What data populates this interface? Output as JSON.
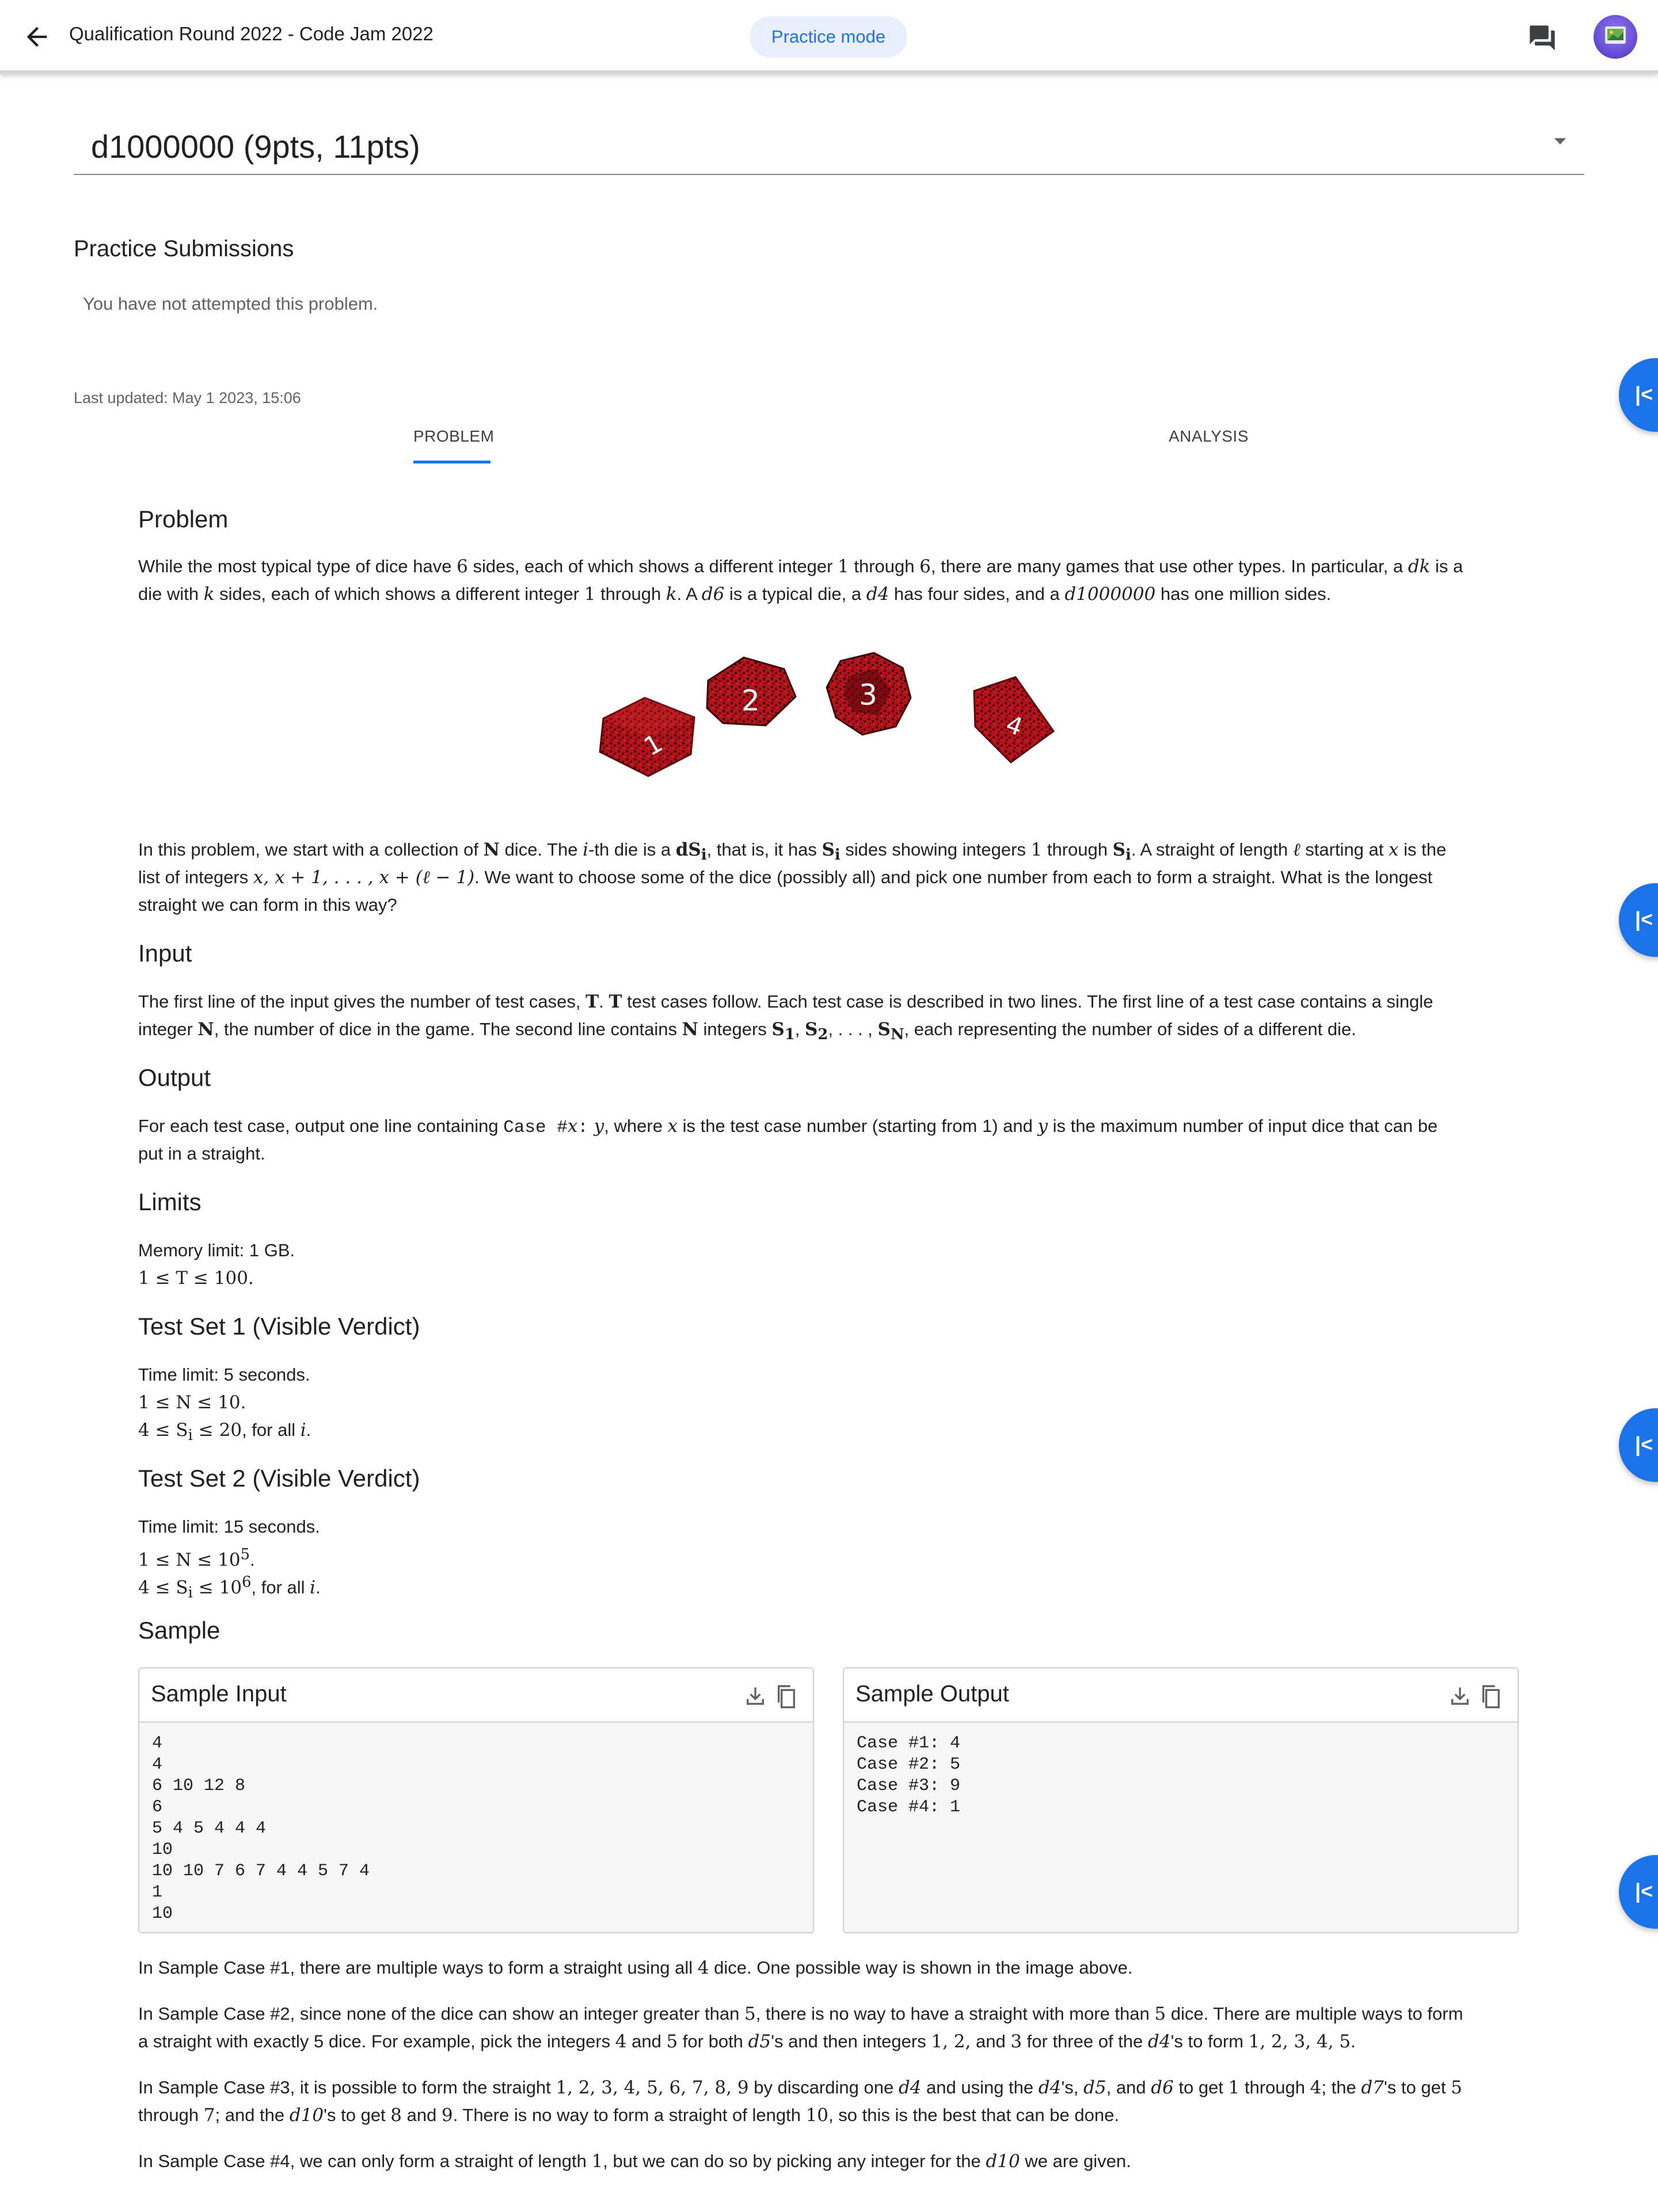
{
  "header": {
    "title": "Qualification Round 2022 - Code Jam 2022",
    "mode_chip": "Practice mode",
    "back_icon": "arrow-back-icon",
    "feedback_icon": "feedback-icon"
  },
  "problem_selector": {
    "title": "d1000000 (9pts, 11pts)"
  },
  "practice": {
    "heading": "Practice Submissions",
    "empty_text": "You have not attempted this problem.",
    "last_updated": "Last updated: May 1 2023, 15:06"
  },
  "tabs": [
    {
      "label": "PROBLEM"
    },
    {
      "label": "ANALYSIS"
    }
  ],
  "side_buttons": {
    "label": "|<"
  },
  "problem": {
    "heading": "Problem",
    "p1": {
      "a": "While the most typical type of dice have ",
      "six": "6",
      "b": " sides, each of which shows a different integer ",
      "one": "1",
      "c": " through ",
      "six2": "6",
      "d": ", there are many games that use other types. In particular, a ",
      "dk": "dk",
      "e": " is a",
      "f": "die with ",
      "k": "k",
      "g": " sides, each of which shows a different integer ",
      "one2": "1",
      "h": " through ",
      "k2": "k",
      "i": ". A ",
      "d6": "d6",
      "j": " is a typical die, a ",
      "d4": "d4",
      "l": " has four sides, and a ",
      "d1m": "d1000000",
      "n": " has one million sides."
    },
    "image_labels": [
      "1",
      "2",
      "3",
      "4"
    ],
    "p2": {
      "a": "In this problem, we start with a collection of ",
      "N": "N",
      "b": " dice. The ",
      "i": "i",
      "c": "-th die is a ",
      "dSi": "dS",
      "sub_i": "i",
      "d": ", that is, it has ",
      "Si": "S",
      "sub_i2": "i",
      "e": " sides showing integers ",
      "one": "1",
      "f": " through ",
      "Si2": "S",
      "sub_i3": "i",
      "g": ". A straight of length ",
      "ell": "ℓ",
      "h": " starting at ",
      "x": "x",
      "j": " is the",
      "line2a": "list of integers ",
      "list": "x, x + 1, . . . , x + (ℓ − 1)",
      "line2b": ". We want to choose some of the dice (possibly all) and pick one number from each to form a straight. What is the longest",
      "line3": "straight we can form in this way?"
    },
    "input_heading": "Input",
    "input": {
      "a": "The first line of the input gives the number of test cases, ",
      "T": "T",
      "b": ". ",
      "T2": "T",
      "c": " test cases follow. Each test case is described in two lines. The first line of a test case contains a single",
      "d": "integer ",
      "N": "N",
      "e": ", the number of dice in the game. The second line contains ",
      "N2": "N",
      "f": " integers ",
      "S_list": "S",
      "s1": "1",
      "comma1": ", ",
      "S2": "S",
      "s2": "2",
      "dots": ", . . . , ",
      "SN": "S",
      "sN": "N",
      "g": ", each representing the number of sides of a different die."
    },
    "output_heading": "Output",
    "output": {
      "a": "For each test case, output one line containing ",
      "code1": "Case #",
      "x": "x",
      "code2": ":",
      "y": " y",
      "b": ", where ",
      "x2": "x",
      "c": " is the test case number (starting from 1) and ",
      "y2": "y",
      "d": " is the maximum number of input dice that can be",
      "e": "put in a straight."
    },
    "limits_heading": "Limits",
    "limits": {
      "memory": "Memory limit: 1 GB.",
      "t_range": "1 ≤ T ≤ 100."
    },
    "ts1_heading": "Test Set 1 (Visible Verdict)",
    "ts1": {
      "time": "Time limit: 5 seconds.",
      "n_range": "1 ≤ N ≤ 10.",
      "s_range": "4 ≤ S",
      "s_sub": "i",
      "s_rest": " ≤ 20",
      "for_all": ", for all ",
      "i": "i",
      "end": "."
    },
    "ts2_heading": "Test Set 2 (Visible Verdict)",
    "ts2": {
      "time": "Time limit: 15 seconds.",
      "n_range": "1 ≤ N ≤ 10",
      "n_exp": "5",
      "n_end": ".",
      "s_range": "4 ≤ S",
      "s_sub": "i",
      "s_rest": " ≤ 10",
      "s_exp": "6",
      "for_all": ", for all ",
      "i": "i",
      "end": "."
    },
    "sample_heading": "Sample",
    "sample_input": {
      "title": "Sample Input",
      "text": "4\n4\n6 10 12 8\n6\n5 4 5 4 4 4\n10\n10 10 7 6 7 4 4 5 7 4\n1\n10"
    },
    "sample_output": {
      "title": "Sample Output",
      "text": "Case #1: 4\nCase #2: 5\nCase #3: 9\nCase #4: 1"
    },
    "explain1": {
      "a": "In Sample Case #1, there are multiple ways to form a straight using all ",
      "four": "4",
      "b": " dice. One possible way is shown in the image above."
    },
    "explain2": {
      "a": "In Sample Case #2, since none of the dice can show an integer greater than ",
      "five": "5",
      "b": ", there is no way to have a straight with more than ",
      "five2": "5",
      "c": " dice. There are multiple ways to form",
      "d": "a straight with exactly 5 dice. For example, pick the integers ",
      "four": "4",
      "e": " and ",
      "five3": "5",
      "f": " for both ",
      "d5": "d5",
      "g": "'s and then integers ",
      "list": "1, 2,",
      "h": " and ",
      "three": "3",
      "i": " for three of the ",
      "d4": "d4",
      "j": "'s to form ",
      "list2": "1, 2, 3, 4, 5",
      "k": "."
    },
    "explain3": {
      "a": "In Sample Case #3, it is possible to form the straight ",
      "list": "1, 2, 3, 4, 5, 6, 7, 8, 9",
      "b": " by discarding one ",
      "d4": "d4",
      "c": " and using the ",
      "d4b": "d4",
      "d": "'s, ",
      "d5": "d5",
      "e": ", and ",
      "d6": "d6",
      "f": " to get ",
      "one": "1",
      "g": " through ",
      "four": "4",
      "h": "; the ",
      "d7": "d7",
      "i": "'s to get ",
      "five": "5",
      "j": "through ",
      "seven": "7",
      "k": "; and the ",
      "d10": "d10",
      "l": "'s to get ",
      "eight": "8",
      "m": " and ",
      "nine": "9",
      "n": ". There is no way to form a straight of length ",
      "ten": "10",
      "o": ", so this is the best that can be done."
    },
    "explain4": {
      "a": "In Sample Case #4, we can only form a straight of length ",
      "one": "1",
      "b": ", but we can do so by picking any integer for the ",
      "d10": "d10",
      "c": " we are given."
    }
  },
  "colors": {
    "accent": "#1a73e8",
    "chip_bg": "#e8f0fe",
    "dice_red": "#b3121a"
  },
  "icons": [
    "arrow-back-icon",
    "feedback-icon",
    "dropdown-caret-icon",
    "download-icon",
    "copy-icon",
    "collapse-left-icon"
  ]
}
